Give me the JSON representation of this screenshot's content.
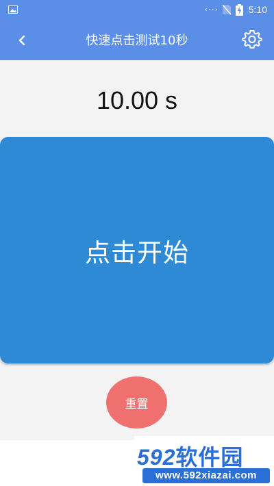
{
  "status_bar": {
    "time": "5:10",
    "icons": [
      "image-icon",
      "network-sync-icon",
      "no-sim-icon",
      "battery-charging-icon"
    ]
  },
  "app_bar": {
    "title": "快速点击测试10秒",
    "back_icon": "chevron-left-icon",
    "settings_icon": "gear-icon"
  },
  "timer": {
    "value": "10.00 s"
  },
  "tap_area": {
    "label": "点击开始"
  },
  "reset_button": {
    "label": "重置"
  },
  "watermark": {
    "brand_num": "592",
    "brand_cn": "软件园",
    "url": "www.592xiazai.com"
  },
  "colors": {
    "app_bar": "#5b8ee6",
    "tap_area": "#2f8ad6",
    "reset_button": "#f07070",
    "background": "#f3f3f3"
  }
}
